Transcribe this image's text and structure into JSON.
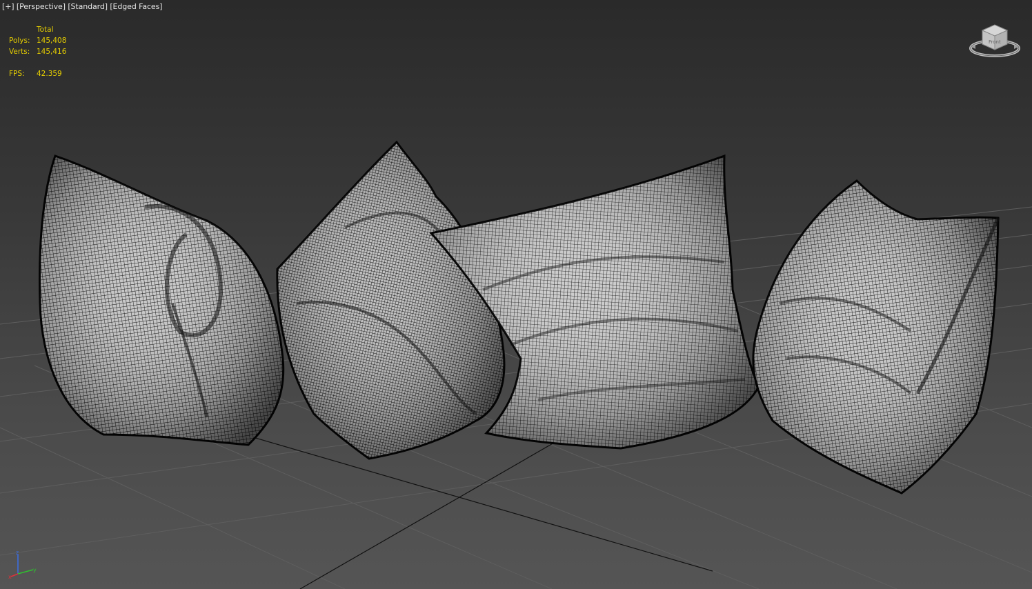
{
  "viewport": {
    "menu": {
      "plus": "[+]",
      "view": "[Perspective]",
      "shading_preset": "[Standard]",
      "display_mode": "[Edged Faces]"
    },
    "stats": {
      "header": "Total",
      "polys_label": "Polys:",
      "polys_value": "145,408",
      "verts_label": "Verts:",
      "verts_value": "145,416",
      "fps_label": "FPS:",
      "fps_value": "42.359"
    },
    "viewcube": {
      "face_label": "Front",
      "icon": "viewcube-icon"
    },
    "axis_tripod": {
      "x": "x",
      "y": "y",
      "z": "z"
    },
    "scene_objects": [
      "pillow-1",
      "pillow-2",
      "pillow-3",
      "pillow-4"
    ],
    "colors": {
      "stats_text": "#e8d000",
      "menu_text": "#e6e6e6",
      "wire": "#000000",
      "surface": "#bdbdbd",
      "grid": "#5e5e5e",
      "axis_x": "#e0303a",
      "axis_y": "#2fc12f",
      "axis_z": "#3a6fe8"
    }
  }
}
